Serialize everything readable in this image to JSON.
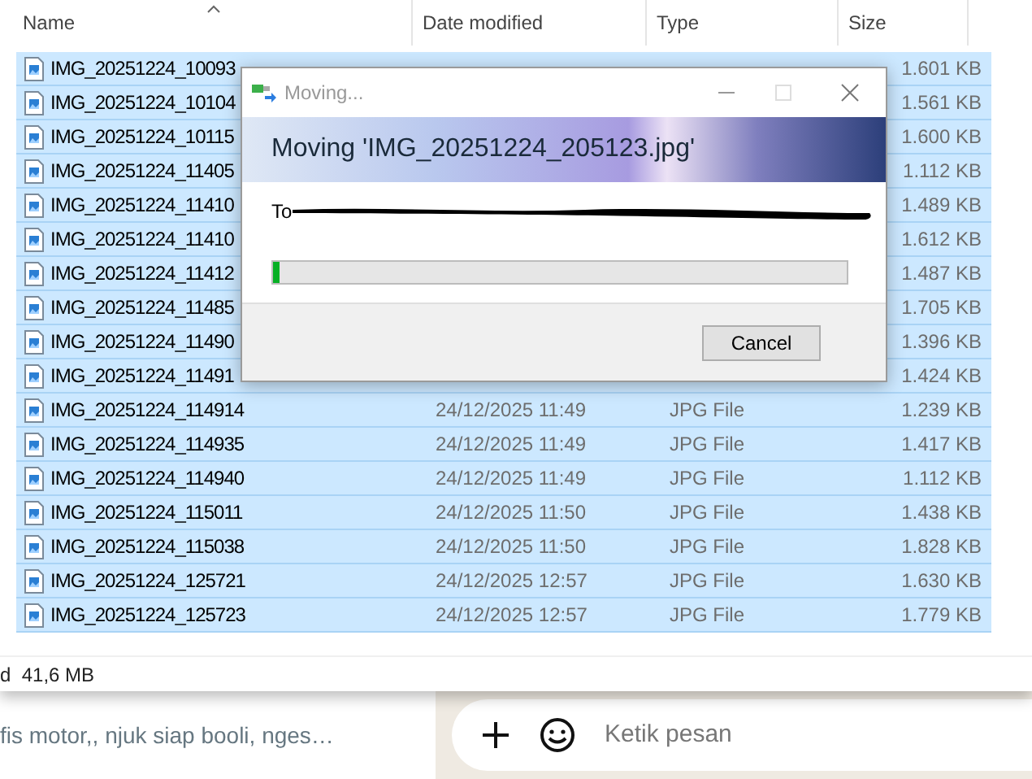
{
  "explorer": {
    "columns": [
      {
        "label": "Name",
        "sorted": true
      },
      {
        "label": "Date modified",
        "sorted": false
      },
      {
        "label": "Type",
        "sorted": false
      },
      {
        "label": "Size",
        "sorted": false
      }
    ],
    "rows": [
      {
        "name": "IMG_20251224_10093",
        "size": "1.601 KB",
        "selected": true
      },
      {
        "name": "IMG_20251224_10104",
        "size": "1.561 KB",
        "selected": true
      },
      {
        "name": "IMG_20251224_10115",
        "size": "1.600 KB",
        "selected": true
      },
      {
        "name": "IMG_20251224_11405",
        "size": "1.112 KB",
        "selected": true
      },
      {
        "name": "IMG_20251224_11410",
        "size": "1.489 KB",
        "selected": true
      },
      {
        "name": "IMG_20251224_11410",
        "size": "1.612 KB",
        "selected": true
      },
      {
        "name": "IMG_20251224_11412",
        "size": "1.487 KB",
        "selected": true
      },
      {
        "name": "IMG_20251224_11485",
        "size": "1.705 KB",
        "selected": true
      },
      {
        "name": "IMG_20251224_11490",
        "size": "1.396 KB",
        "selected": true
      },
      {
        "name": "IMG_20251224_11491",
        "size": "1.424 KB",
        "selected": true
      },
      {
        "name": "IMG_20251224_114914",
        "date": "24/12/2025 11:49",
        "type": "JPG File",
        "size": "1.239 KB",
        "selected": true
      },
      {
        "name": "IMG_20251224_114935",
        "date": "24/12/2025 11:49",
        "type": "JPG File",
        "size": "1.417 KB",
        "selected": true
      },
      {
        "name": "IMG_20251224_114940",
        "date": "24/12/2025 11:49",
        "type": "JPG File",
        "size": "1.112 KB",
        "selected": true
      },
      {
        "name": "IMG_20251224_115011",
        "date": "24/12/2025 11:50",
        "type": "JPG File",
        "size": "1.438 KB",
        "selected": true
      },
      {
        "name": "IMG_20251224_115038",
        "date": "24/12/2025 11:50",
        "type": "JPG File",
        "size": "1.828 KB",
        "selected": true
      },
      {
        "name": "IMG_20251224_125721",
        "date": "24/12/2025 12:57",
        "type": "JPG File",
        "size": "1.630 KB",
        "selected": true
      },
      {
        "name": "IMG_20251224_125723",
        "date": "24/12/2025 12:57",
        "type": "JPG File",
        "size": "1.779 KB",
        "selected": true
      }
    ],
    "status_bar": "d  41,6 MB"
  },
  "dialog": {
    "title": "Moving...",
    "heading": "Moving 'IMG_20251224_205123.jpg'",
    "destination_label": "To",
    "progress": {
      "level": 0.01
    },
    "buttons": [
      "Cancel"
    ]
  },
  "chat": {
    "preview": "fis motor,, njuk siap booli, nges…",
    "message_placeholder": "Ketik pesan"
  }
}
